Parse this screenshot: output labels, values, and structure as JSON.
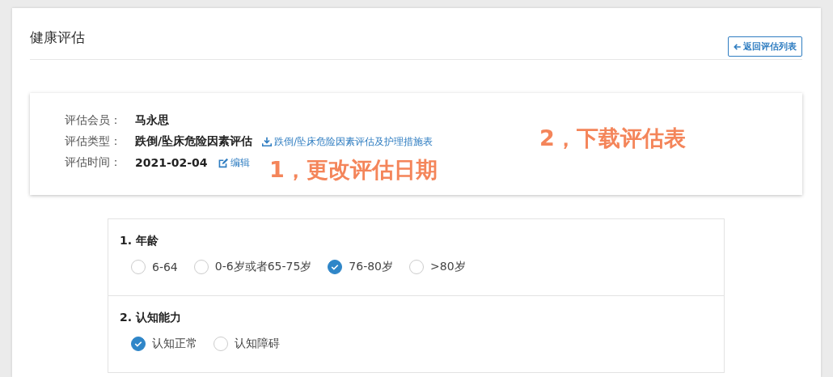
{
  "page": {
    "title": "健康评估",
    "back_button": "返回评估列表"
  },
  "info": [
    {
      "kind": "text",
      "label": "评估会员：",
      "value": "马永思"
    },
    {
      "kind": "download",
      "label": "评估类型：",
      "value": "跌倒/坠床危险因素评估",
      "link": "跌倒/坠床危险因素评估及护理措施表"
    },
    {
      "kind": "edit",
      "label": "评估时间：",
      "value": "2021-02-04",
      "link": "编辑"
    }
  ],
  "annotations": [
    {
      "text": "1，更改评估日期"
    },
    {
      "text": "2，下载评估表"
    }
  ],
  "questions": [
    {
      "title": "1. 年龄",
      "options": [
        {
          "label": "6-64",
          "selected": false
        },
        {
          "label": "0-6岁或者65-75岁",
          "selected": false
        },
        {
          "label": "76-80岁",
          "selected": true
        },
        {
          "label": ">80岁",
          "selected": false
        }
      ]
    },
    {
      "title": "2. 认知能力",
      "options": [
        {
          "label": "认知正常",
          "selected": true
        },
        {
          "label": "认知障碍",
          "selected": false
        }
      ]
    }
  ]
}
